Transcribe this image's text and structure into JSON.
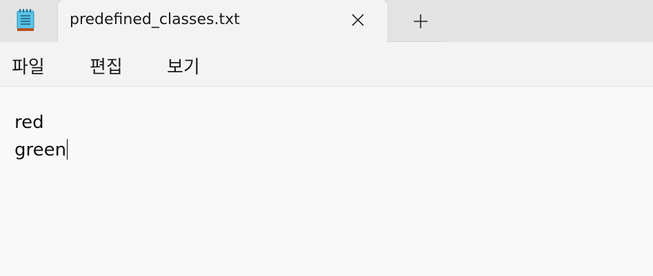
{
  "app": {
    "icon": "notepad-icon"
  },
  "tab": {
    "title": "predefined_classes.txt",
    "close_icon": "close-icon"
  },
  "new_tab": {
    "icon": "plus-icon"
  },
  "menu": {
    "items": [
      {
        "label": "파일"
      },
      {
        "label": "편집"
      },
      {
        "label": "보기"
      }
    ]
  },
  "editor": {
    "lines": [
      "red",
      "green"
    ]
  },
  "colors": {
    "tabstrip_bg": "#e3e3e3",
    "tab_bg": "#f3f3f3",
    "editor_bg": "#f9f9f9",
    "notepad_blue": "#5ac3e8",
    "notepad_orange": "#b5501f"
  }
}
